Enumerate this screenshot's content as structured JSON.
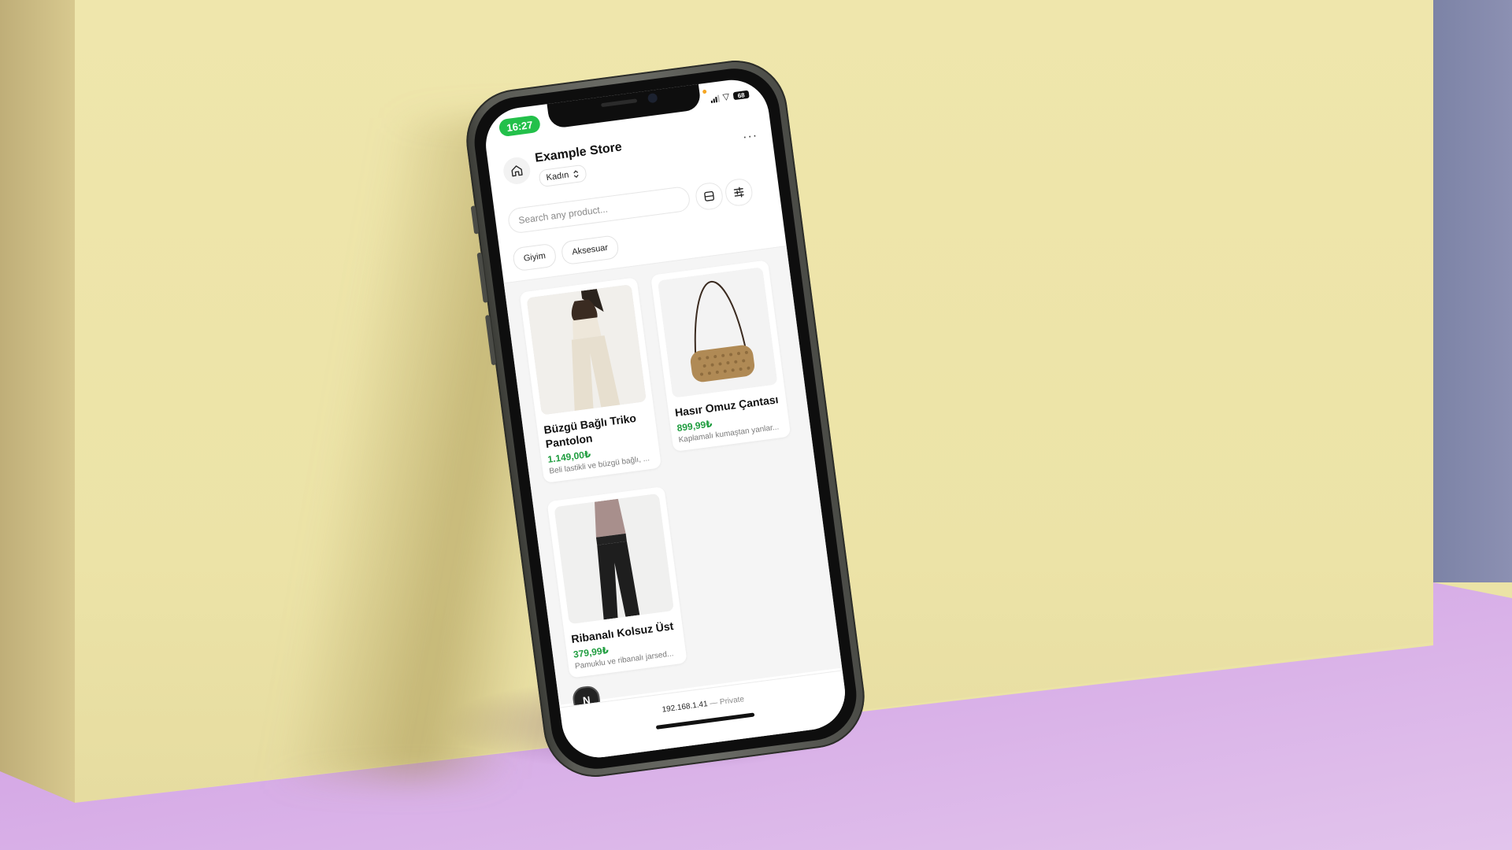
{
  "status_bar": {
    "time": "16:27",
    "battery": "68"
  },
  "header": {
    "store_name": "Example Store",
    "category_selected": "Kadın",
    "more_label": "···"
  },
  "search": {
    "placeholder": "Search any product..."
  },
  "chips": [
    {
      "label": "Giyim"
    },
    {
      "label": "Aksesuar"
    }
  ],
  "products": [
    {
      "name": "Büzgü Bağlı Triko Pantolon",
      "price": "1.149,00₺",
      "description": "Beli lastikli ve büzgü bağlı, ..."
    },
    {
      "name": "Hasır Omuz Çantası",
      "price": "899,99₺",
      "description": "Kaplamalı kumaştan yanlar..."
    },
    {
      "name": "Ribanalı Kolsuz Üst",
      "price": "379,99₺",
      "description": "Pamuklu ve ribanalı jarsed..."
    }
  ],
  "badge": {
    "letter": "N"
  },
  "browser": {
    "url": "192.168.1.41",
    "mode": "— Private"
  },
  "colors": {
    "accent_green": "#23c04a",
    "price_green": "#1f9d3f",
    "wall": "#ebe3a6",
    "floor": "#c98fe0"
  },
  "icons": [
    "home-icon",
    "chevron-updown-icon",
    "more-icon",
    "layout-icon",
    "filter-icon",
    "signal-icon",
    "wifi-icon",
    "battery-icon"
  ]
}
